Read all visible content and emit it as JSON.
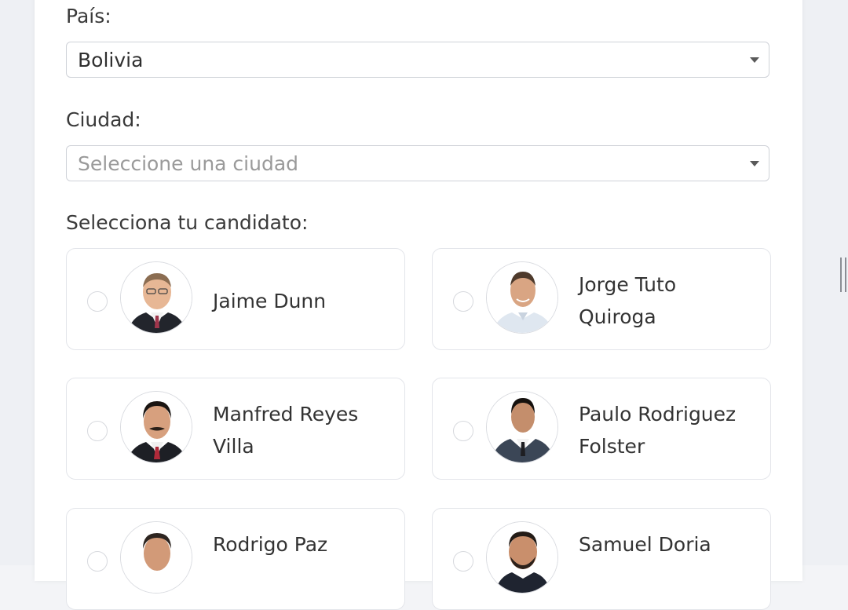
{
  "form": {
    "country_label": "País:",
    "country_value": "Bolivia",
    "city_label": "Ciudad:",
    "city_placeholder": "Seleccione una ciudad",
    "candidate_label": "Selecciona tu candidato:"
  },
  "candidates": [
    {
      "name": "Jaime Dunn",
      "selected": false
    },
    {
      "name": "Jorge Tuto Quiroga",
      "selected": false
    },
    {
      "name": "Manfred Reyes Villa",
      "selected": false
    },
    {
      "name": "Paulo Rodriguez Folster",
      "selected": false
    },
    {
      "name": "Rodrigo Paz",
      "selected": false
    },
    {
      "name": "Samuel Doria",
      "selected": false
    }
  ],
  "icons": {
    "select_caret": "chevron-down-icon",
    "scroll_handle": "scroll-handle-icon"
  },
  "colors": {
    "page_background": "#f3f4f7",
    "card_background": "#ffffff",
    "border": "#cfd2d8",
    "placeholder_text": "#9a9a9a",
    "text": "#333333"
  }
}
